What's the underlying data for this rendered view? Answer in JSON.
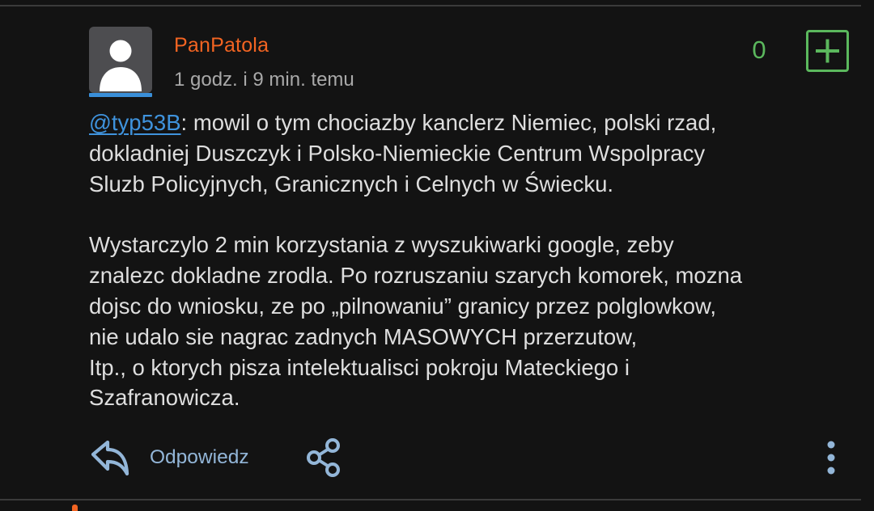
{
  "comment": {
    "author": "PanPatola",
    "time": "1 godz. i 9 min. temu",
    "votes": "0",
    "mention": "@typ53B",
    "lines_p1": [
      ": mowil o tym chociazby kanclerz Niemiec, polski rzad,",
      "dokladniej Duszczyk i Polsko-Niemieckie Centrum Wspolpracy",
      "Sluzb Policyjnych, Granicznych i Celnych w Świecku."
    ],
    "lines_p2": [
      "Wystarczylo 2 min korzystania z wyszukiwarki google, zeby",
      "znalezc dokladne zrodla. Po rozruszaniu szarych komorek, mozna",
      "dojsc do wniosku, ze po „pilnowaniu” granicy przez polglowkow,",
      "nie udalo sie nagrac zadnych MASOWYCH przerzutow,",
      "Itp., o ktorych pisza intelektualisci pokroju Mateckiego i",
      "Szafranowicza."
    ]
  },
  "actions": {
    "reply_label": "Odpowiedz"
  },
  "icons": {
    "avatar": "user-silhouette-icon",
    "upvote": "plus-box-icon",
    "reply": "reply-arrow-icon",
    "share": "share-nodes-icon",
    "more": "vertical-dots-icon"
  },
  "colors": {
    "background": "#131313",
    "username": "#f26422",
    "vote": "#5bb85d",
    "mention": "#3f93dd",
    "reply_label": "#93b6d8",
    "body_text": "#dedede",
    "timestamp": "#a9a9a9"
  }
}
